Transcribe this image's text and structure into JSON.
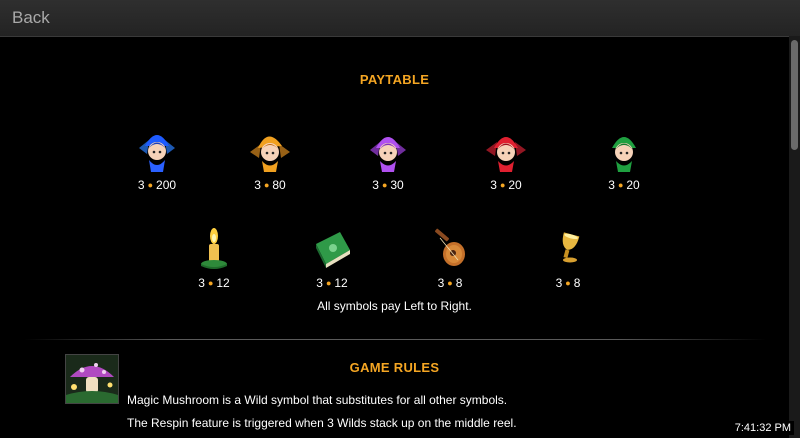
{
  "topbar": {
    "back_label": "Back"
  },
  "paytable": {
    "title": "PAYTABLE",
    "row1": [
      {
        "icon": "blue-fairy-icon",
        "count": "3",
        "value": "200"
      },
      {
        "icon": "orange-fairy-icon",
        "count": "3",
        "value": "80"
      },
      {
        "icon": "purple-fairy-icon",
        "count": "3",
        "value": "30"
      },
      {
        "icon": "red-fairy-icon",
        "count": "3",
        "value": "20"
      },
      {
        "icon": "green-fairy-icon",
        "count": "3",
        "value": "20"
      }
    ],
    "row2": [
      {
        "icon": "candle-icon",
        "count": "3",
        "value": "12"
      },
      {
        "icon": "spellbook-icon",
        "count": "3",
        "value": "12"
      },
      {
        "icon": "lute-icon",
        "count": "3",
        "value": "8"
      },
      {
        "icon": "goblet-icon",
        "count": "3",
        "value": "8"
      }
    ],
    "note": "All symbols pay Left to Right."
  },
  "rules": {
    "title": "GAME RULES",
    "image_icon": "magic-mushroom-icon",
    "lines": [
      "Magic Mushroom is a Wild symbol that substitutes for all other symbols.",
      "The Respin feature is triggered when 3 Wilds stack up on the middle reel."
    ]
  },
  "clock": "7:41:32 PM",
  "colors": {
    "accent": "#f5a623",
    "background": "#000000",
    "topbar": "#2a2a2a"
  }
}
